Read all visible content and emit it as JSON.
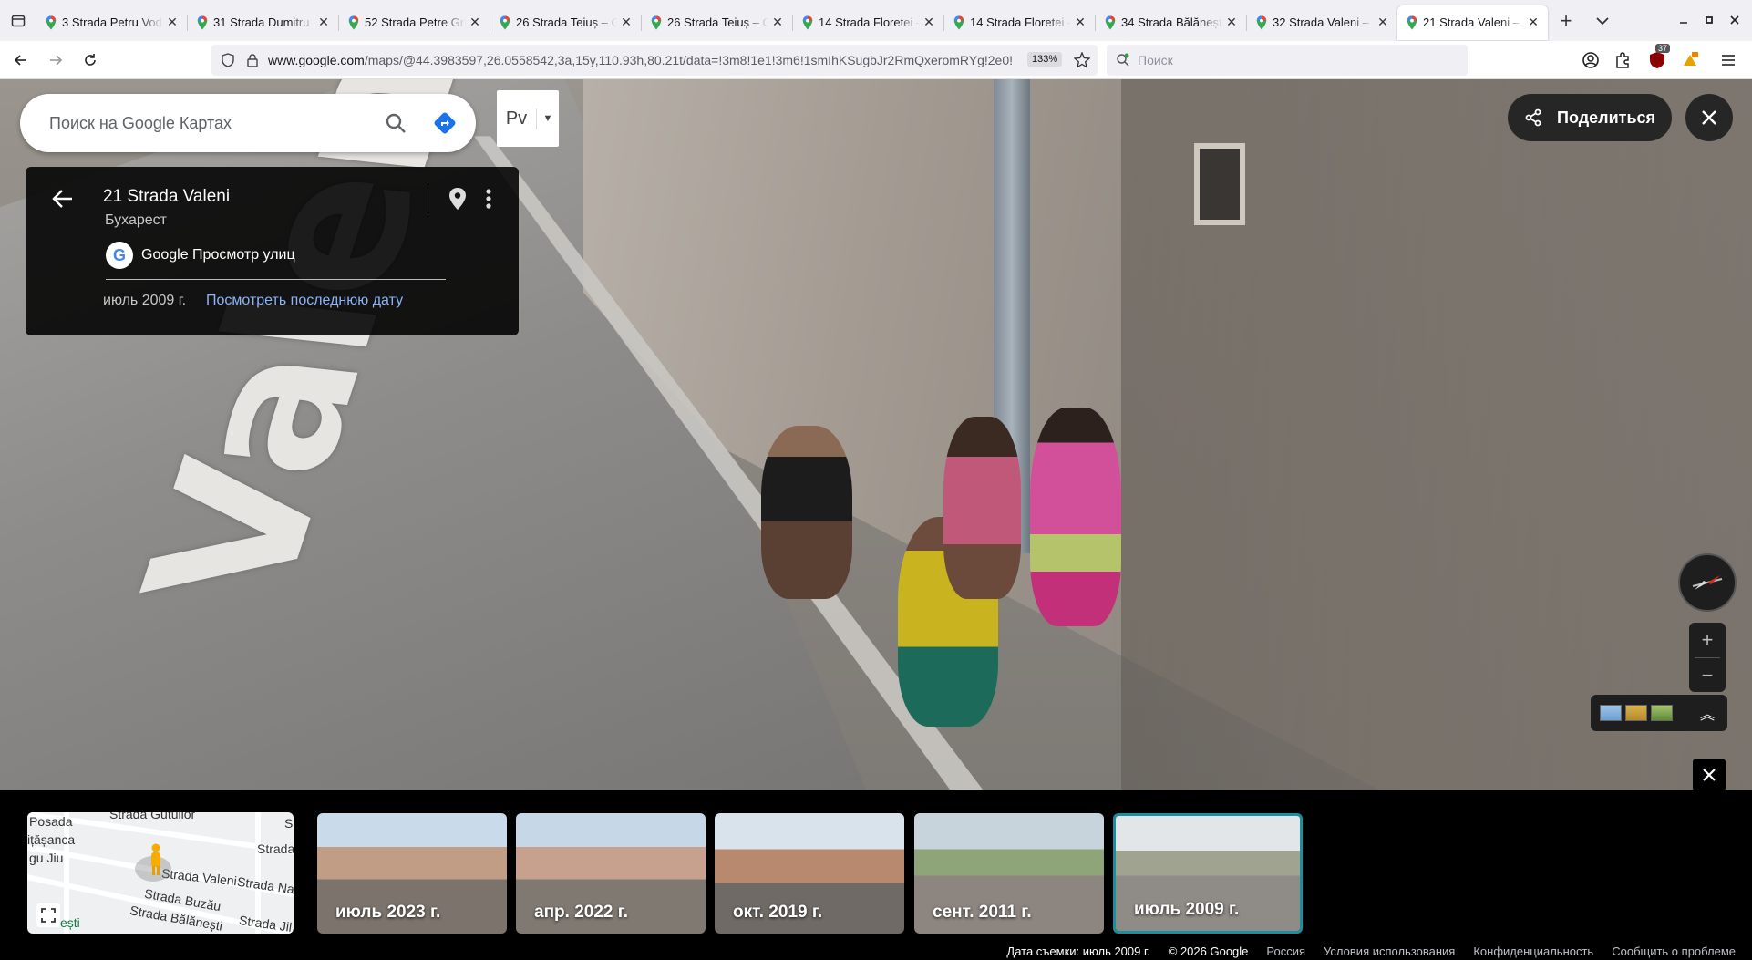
{
  "browser": {
    "tabs": [
      {
        "title": "3 Strada Petru Vod",
        "active": false
      },
      {
        "title": "31 Strada Dumitru",
        "active": false
      },
      {
        "title": "52 Strada Petre Gri",
        "active": false
      },
      {
        "title": "26 Strada Teiuș – G",
        "active": false
      },
      {
        "title": "26 Strada Teiuș – G",
        "active": false
      },
      {
        "title": "14 Strada Floretei –",
        "active": false
      },
      {
        "title": "14 Strada Floretei –",
        "active": false
      },
      {
        "title": "34 Strada Bălănești",
        "active": false
      },
      {
        "title": "32 Strada Valeni – I",
        "active": false
      },
      {
        "title": "21 Strada Valeni – I",
        "active": true
      }
    ],
    "url_host": "www.google.com",
    "url_path": "/maps/@44.3983597,26.0558542,3a,15y,110.93h,80.21t/data=!3m8!1e1!3m6!1smIhKSugbJr2RmQxeromRYg!2e0!",
    "zoom": "133%",
    "search_placeholder": "Поиск",
    "extensions_badge": "37",
    "colors": {
      "accent": "#1a73e8",
      "tab_strip": "#f0f0f4"
    }
  },
  "maps": {
    "search_placeholder": "Поиск на Google Картах",
    "lang_label": "Рv",
    "share_label": "Поделиться"
  },
  "info_card": {
    "title": "21 Strada Valeni",
    "subtitle": "Бухарест",
    "source": "Google Просмотр улиц",
    "date": "июль 2009 г.",
    "latest_link": "Посмотреть последнюю дату"
  },
  "scene": {
    "road_marking": "Valeni"
  },
  "minimap": {
    "labels": [
      "Strada Gutullor",
      "Posada",
      "ițășanca",
      "gu Jiu",
      "Strada Valeni",
      "Strada",
      "Strada Na",
      "Strada Buzău",
      "Strada Bălănești",
      "Strada Jil",
      "ești",
      "S"
    ]
  },
  "filmstrip": [
    {
      "caption": "июль 2023 г.",
      "selected": false
    },
    {
      "caption": "апр. 2022 г.",
      "selected": false
    },
    {
      "caption": "окт. 2019 г.",
      "selected": false
    },
    {
      "caption": "сент. 2011 г.",
      "selected": false
    },
    {
      "caption": "июль 2009 г.",
      "selected": true
    }
  ],
  "footer": {
    "capture_date": "Дата съемки: июль 2009 г.",
    "copyright": "© 2026 Google",
    "country": "Россия",
    "terms": "Условия использования",
    "privacy": "Конфиденциальность",
    "report": "Сообщить о проблеме"
  }
}
